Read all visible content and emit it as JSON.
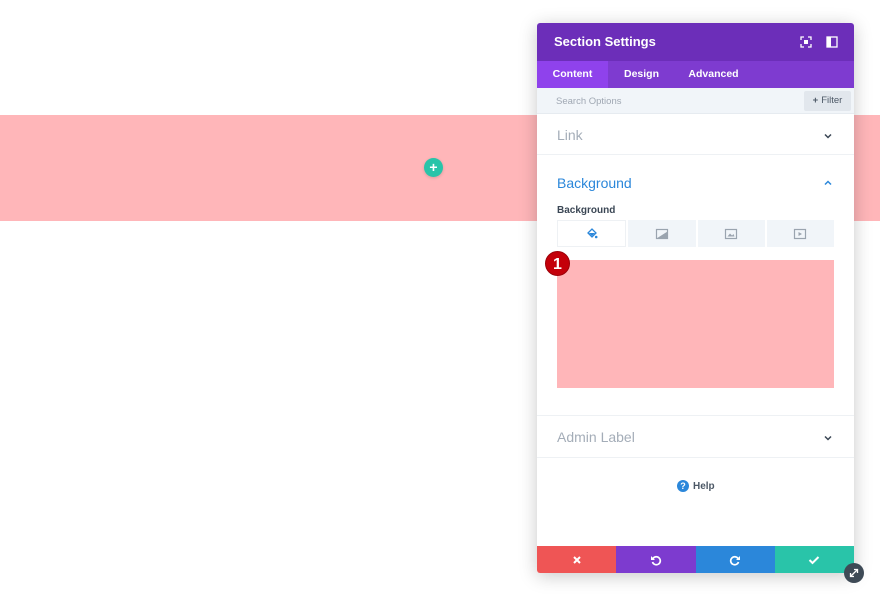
{
  "canvas": {
    "section_color": "#ffb6b9",
    "add_row_icon": "plus-icon"
  },
  "modal": {
    "title": "Section Settings",
    "header_icons": [
      "expand-icon",
      "dock-sidebar-icon"
    ],
    "tabs": [
      {
        "label": "Content",
        "active": true
      },
      {
        "label": "Design",
        "active": false
      },
      {
        "label": "Advanced",
        "active": false
      }
    ],
    "search": {
      "placeholder": "Search Options",
      "value": ""
    },
    "filter_label": "Filter",
    "toggles": {
      "link": {
        "title": "Link",
        "open": false
      },
      "background": {
        "title": "Background",
        "open": true,
        "field_label": "Background",
        "type_tabs": [
          "paint-bucket-icon",
          "gradient-icon",
          "image-icon",
          "video-icon"
        ],
        "selected_type": "paint-bucket-icon",
        "color": "#ffb6b9",
        "marker": "1"
      },
      "admin_label": {
        "title": "Admin Label",
        "open": false
      }
    },
    "help_label": "Help",
    "footer": [
      "cancel-icon",
      "undo-icon",
      "redo-icon",
      "save-check-icon"
    ],
    "colors": {
      "header": "#6c2eb9",
      "tab_bar": "#7e3bd0",
      "active_tab": "#8f42ec",
      "accent_blue": "#2b87da",
      "cancel": "#ef5555",
      "undo": "#7d3bcf",
      "redo": "#2b87da",
      "save": "#29c4a9"
    }
  }
}
